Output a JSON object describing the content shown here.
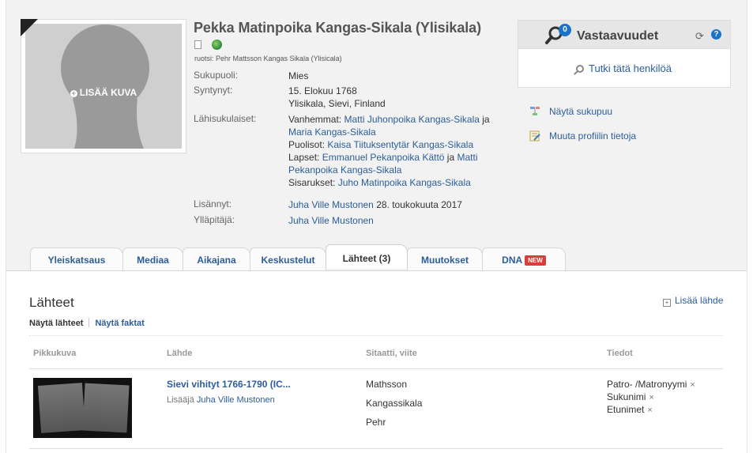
{
  "profile": {
    "name": "Pekka Matinpoika Kangas-Sikala (Ylisikala)",
    "alt_name": "ruotsi: Pehr Mattsson Kangas Sikala (Ylisicala)",
    "add_photo_label": "LISÄÄ KUVA",
    "facts": {
      "gender_label": "Sukupuoli:",
      "gender": "Mies",
      "born_label": "Syntynyt:",
      "born_date": "15. Elokuu 1768",
      "born_place": "Ylisikala, Sievi, Finland",
      "relatives_label": "Lähisukulaiset:",
      "parents_prefix": "Vanhemmat: ",
      "father": "Matti Juhonpoika Kangas-Sikala",
      "and1": " ja",
      "mother": "Maria Kangas-Sikala",
      "spouse_prefix": "Puolisot: ",
      "spouse": "Kaisa Tiituksentytär Kangas-Sikala",
      "children_prefix": "Lapset: ",
      "child1": "Emmanuel Pekanpoika Kättö",
      "and2": " ja ",
      "child2a": "Matti",
      "child2b": "Pekanpoika Kangas-Sikala",
      "siblings_prefix": "Sisarukset: ",
      "sibling": "Juho Matinpoika Kangas-Sikala",
      "added_label": "Lisännyt:",
      "added_by": "Juha Ville Mustonen",
      "added_date": " 28. toukokuuta 2017",
      "manager_label": "Ylläpitäjä:",
      "manager": "Juha Ville Mustonen"
    }
  },
  "answers_panel": {
    "title": "Vastaavuudet",
    "count": "0",
    "research_link": "Tutki tätä henkilöä",
    "help": "?"
  },
  "side_links": {
    "show_tree": "Näytä sukupuu",
    "edit_profile": "Muuta profiilin tietoja"
  },
  "tabs": [
    {
      "label": "Yleiskatsaus"
    },
    {
      "label": "Mediaa"
    },
    {
      "label": "Aikajana"
    },
    {
      "label": "Keskustelut"
    },
    {
      "label": "Lähteet (3)"
    },
    {
      "label": "Muutokset"
    },
    {
      "label": "DNA",
      "badge": "NEW"
    }
  ],
  "sources": {
    "title": "Lähteet",
    "add_source": "Lisää lähde",
    "filter_active": "Näytä lähteet",
    "filter_other": "Näytä faktat",
    "columns": [
      "Pikkukuva",
      "Lähde",
      "Sitaatti, viite",
      "Tiedot"
    ],
    "row": {
      "source_title": "Sievi vihityt 1766-1790 (IC...",
      "added_prefix": "Lisääjä ",
      "added_by": "Juha Ville Mustonen",
      "citations": [
        "Mathsson",
        "Kangassikala",
        "Pehr"
      ],
      "info": [
        "Patro- /Matronyymi",
        "Sukunimi",
        "Etunimet"
      ],
      "remove": "×"
    }
  },
  "colors": {
    "link": "#2b5d9a",
    "badge_blue": "#1a73c9",
    "new_badge": "#d43f3a",
    "band": "#f2f2f2"
  }
}
